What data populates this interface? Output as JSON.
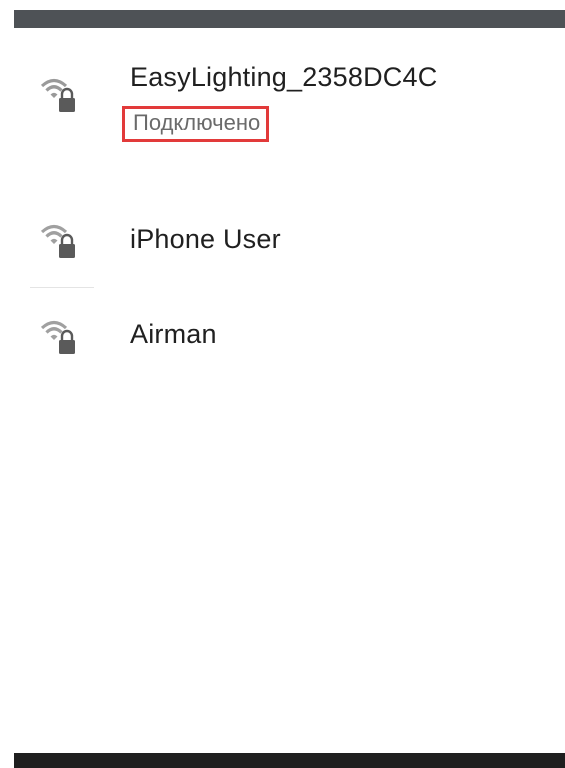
{
  "networks": [
    {
      "ssid": "EasyLighting_2358DC4C",
      "status": "Подключено",
      "icon": "wifi-secured-icon",
      "connected": true
    },
    {
      "ssid": "iPhone User",
      "icon": "wifi-secured-icon",
      "connected": false
    },
    {
      "ssid": "Airman",
      "icon": "wifi-secured-icon",
      "connected": false
    }
  ],
  "colors": {
    "top_bar": "#4e5256",
    "bottom_bar": "#1f1f1f",
    "highlight_border": "#e23a3a",
    "text": "#202020",
    "status_text": "#6a6a6a",
    "icon_gray": "#9a9a9a"
  }
}
